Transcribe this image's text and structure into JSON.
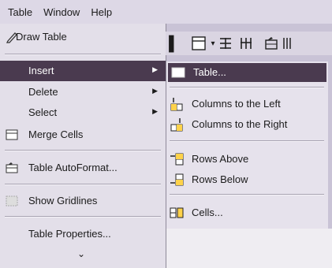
{
  "menubar": {
    "items": [
      "Table",
      "Window",
      "Help"
    ]
  },
  "main_menu": {
    "draw_table": "Draw Table",
    "insert": "Insert",
    "delete": "Delete",
    "select": "Select",
    "merge_cells": "Merge Cells",
    "autoformat": "Table AutoFormat...",
    "show_gridlines": "Show Gridlines",
    "properties": "Table Properties...",
    "expand": "⌄"
  },
  "insert_submenu": {
    "table": "Table...",
    "columns_left": "Columns to the Left",
    "columns_right": "Columns to the Right",
    "rows_above": "Rows Above",
    "rows_below": "Rows Below",
    "cells": "Cells..."
  },
  "colors": {
    "highlight": "#4a3a4f",
    "menu_bg": "#e3dfe9"
  }
}
